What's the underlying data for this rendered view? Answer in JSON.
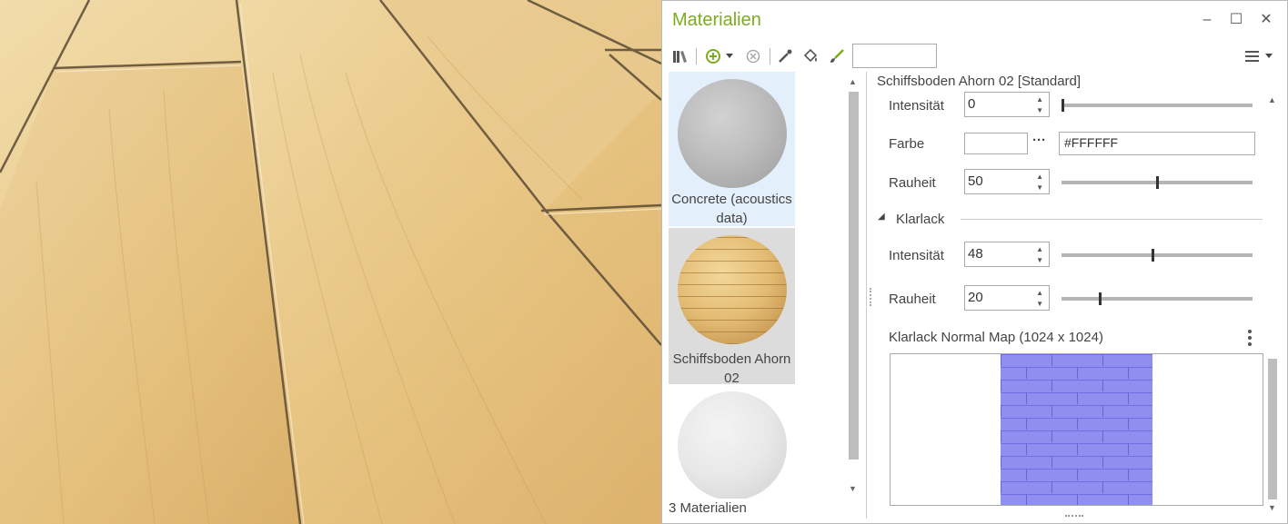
{
  "panel": {
    "title": "Materialien",
    "window_buttons": {
      "minimize": "–",
      "maximize": "☐",
      "close": "✕"
    },
    "search_value": ""
  },
  "materials": [
    {
      "label": "Concrete (acoustics data)",
      "selected": true
    },
    {
      "label": "Schiffsboden Ahorn 02",
      "selected": false
    },
    {
      "label": "",
      "selected": false
    }
  ],
  "materials_count": "3 Materialien",
  "properties": {
    "header": "Schiffsboden Ahorn 02 [Standard]",
    "intensitaet_1": {
      "label": "Intensität",
      "value": "0",
      "level": 0
    },
    "farbe": {
      "label": "Farbe",
      "hex": "#FFFFFF",
      "swatch": "#FFFFFF"
    },
    "rauheit_1": {
      "label": "Rauheit",
      "value": "50",
      "level": 50
    },
    "klarlack_section": "Klarlack",
    "intensitaet_2": {
      "label": "Intensität",
      "value": "48",
      "level": 48
    },
    "rauheit_2": {
      "label": "Rauheit",
      "value": "20",
      "level": 20
    },
    "normal_map_label": "Klarlack Normal Map (1024 x 1024)"
  },
  "colors": {
    "accent": "#7BAC1F",
    "normal_map": "#8585EE"
  }
}
